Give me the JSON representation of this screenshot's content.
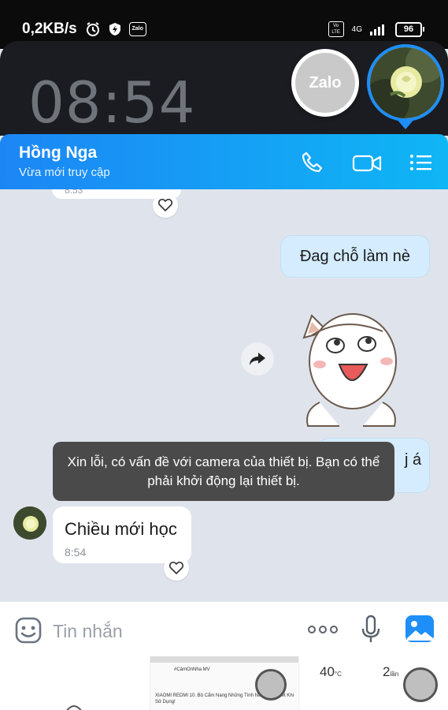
{
  "status_bar": {
    "speed": "0,2KB/s",
    "network": "4G",
    "volte": "Vo LTE",
    "battery": "96",
    "zalo_icon_label": "Zalo"
  },
  "lock_clock": "08:54",
  "zalo_bubble_label": "Zalo",
  "header": {
    "name": "Hồng Nga",
    "status": "Vừa mới truy cập"
  },
  "messages": {
    "prev_time": "8:53",
    "outgoing_1": "Đag chỗ làm nè",
    "outgoing_2_partial": "j á",
    "incoming_text": "Chiều mới học",
    "incoming_time": "8:54"
  },
  "toast": "Xin lỗi, có vấn đề với camera của thiết bị. Bạn có thể phải khởi động lại thiết bị.",
  "input": {
    "placeholder": "Tin nhắn"
  },
  "bottom": {
    "thumb_badge": "#CảmOnNha MV",
    "thumb_text": "XIAOMI REDMI 10. Bộ Cẩm Nang Những Tính Năng Nên Biết Khi Sử Dụng!",
    "weather_temp": "40",
    "weather_unit": "°C",
    "count": "2",
    "count_unit": "lần"
  },
  "colors": {
    "header_start": "#1c86f5",
    "header_end": "#0fb6f5",
    "outgoing_bubble": "#d4ecfd",
    "toast_bg": "#4a4a4a",
    "accent": "#1e8ef8"
  }
}
